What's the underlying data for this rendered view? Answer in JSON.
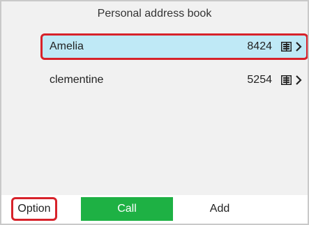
{
  "header": {
    "title": "Personal address book"
  },
  "contacts": [
    {
      "name": "Amelia",
      "number": "8424",
      "selected": true,
      "icon": "address-book-icon"
    },
    {
      "name": "clementine",
      "number": "5254",
      "selected": false,
      "icon": "address-book-icon"
    }
  ],
  "softkeys": {
    "option": "Option",
    "call": "Call",
    "add": "Add"
  },
  "colors": {
    "selection_bg": "#bfe9f6",
    "highlight_border": "#d7222a",
    "call_green": "#1eb144"
  }
}
